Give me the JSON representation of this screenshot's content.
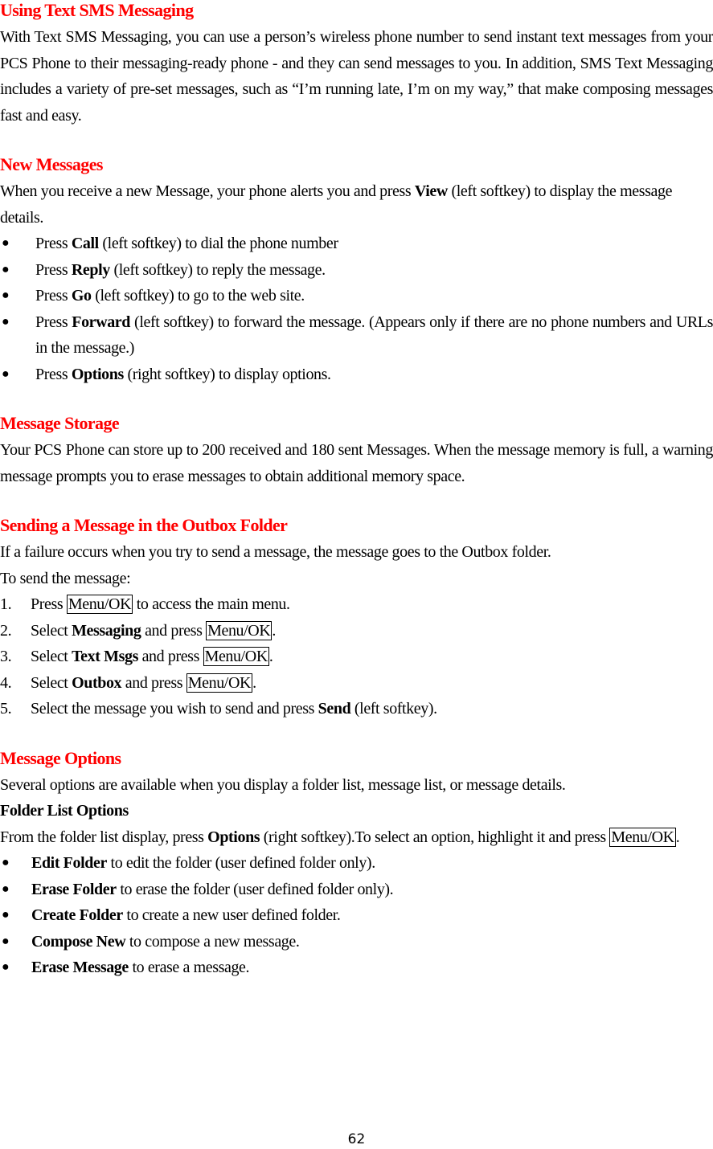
{
  "sections": {
    "sms": {
      "title": "Using Text SMS Messaging",
      "body": "With Text SMS Messaging, you can use a person’s wireless phone number to send instant text messages from your PCS Phone to their messaging-ready phone - and they can send messages to you. In addition, SMS Text Messaging includes a variety of pre-set messages, such as “I’m running late, I’m on my way,” that make composing messages fast and easy."
    },
    "new_messages": {
      "title": "New Messages",
      "intro_pre": "When you receive a new Message, your phone alerts you and press ",
      "intro_bold": "View",
      "intro_post": " (left softkey) to display the message details.",
      "bullets": [
        {
          "pre": "Press ",
          "bold": "Call",
          "post": " (left softkey) to dial the phone number"
        },
        {
          "pre": "Press ",
          "bold": "Reply",
          "post": " (left softkey) to reply the message."
        },
        {
          "pre": "Press ",
          "bold": "Go",
          "post": " (left softkey) to go to the web site."
        },
        {
          "pre": "Press ",
          "bold": "Forward",
          "post": " (left softkey) to forward the message. (Appears only if there are no phone numbers and URLs in the message.)"
        },
        {
          "pre": "Press ",
          "bold": "Options",
          "post": " (right softkey) to display options."
        }
      ]
    },
    "storage": {
      "title": "Message Storage",
      "body": "Your PCS Phone can store up to 200 received and 180 sent Messages. When the message memory is full, a warning message prompts you to erase messages to obtain additional memory space."
    },
    "outbox": {
      "title": "Sending a Message in the Outbox Folder",
      "line1": "If a failure occurs when you try to send a message, the message goes to the Outbox folder.",
      "line2": "To send the message:",
      "key": "Menu/OK",
      "steps": [
        {
          "num": "1.",
          "pre": "Press ",
          "post": " to access the main menu."
        },
        {
          "num": "2.",
          "pre": "Select ",
          "bold": "Messaging",
          "mid": " and press ",
          "post": "."
        },
        {
          "num": "3.",
          "pre": "Select ",
          "bold": "Text Msgs",
          "mid": " and press ",
          "post": "."
        },
        {
          "num": "4.",
          "pre": "Select ",
          "bold": "Outbox",
          "mid": " and press ",
          "post": "."
        },
        {
          "num": "5.",
          "pre": "Select the message you wish to send and press ",
          "bold": "Send",
          "post": " (left softkey)."
        }
      ]
    },
    "options": {
      "title": "Message Options",
      "intro": "Several options are available when you display a folder list, message list, or message details.",
      "subtitle": "Folder List Options",
      "line_pre": "From the folder list display, press ",
      "line_bold": "Options",
      "line_mid": " (right softkey).To select an option, highlight it and press ",
      "line_key": "Menu/OK",
      "line_post": ".",
      "bullets": [
        {
          "bold": "Edit Folder",
          "post": " to edit the folder (user defined folder only)."
        },
        {
          "bold": "Erase Folder",
          "post": " to erase the folder (user defined folder only)."
        },
        {
          "bold": "Create Folder",
          "post": " to create a new user defined folder."
        },
        {
          "bold": "Compose New",
          "post": " to compose a new message."
        },
        {
          "bold": "Erase Message",
          "post": " to erase a message."
        }
      ]
    }
  },
  "bullet_glyph": "●",
  "heading_color": "#ff0000",
  "page_number": "62"
}
